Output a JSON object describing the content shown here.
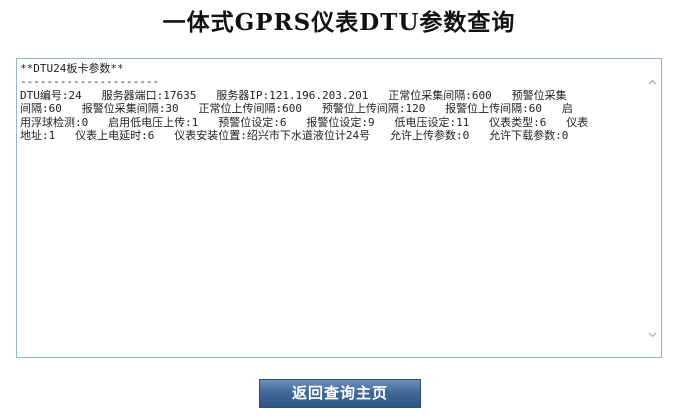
{
  "page": {
    "title": "一体式GPRS仪表DTU参数查询"
  },
  "params_textarea": {
    "content": "**DTU24板卡参数**\n---------------------\nDTU编号:24   服务器端口:17635   服务器IP:121.196.203.201   正常位采集间隔:600   预警位采集\n间隔:60   报警位采集间隔:30   正常位上传间隔:600   预警位上传间隔:120   报警位上传间隔:60   启\n用浮球检测:0   启用低电压上传:1   预警位设定:6   报警位设定:9   低电压设定:11   仪表类型:6   仪表\n地址:1   仪表上电延时:6   仪表安装位置:绍兴市下水道液位计24号   允许上传参数:0   允许下载参数:0"
  },
  "icons": {
    "scroll_up": "chevron-up-icon",
    "scroll_down": "chevron-down-icon"
  },
  "actions": {
    "back_label": "返回查询主页"
  },
  "colors": {
    "textarea_border": "#8fb9c9",
    "button_bg": "#3f6695",
    "button_text": "#ffffff",
    "title_text": "#111111"
  }
}
